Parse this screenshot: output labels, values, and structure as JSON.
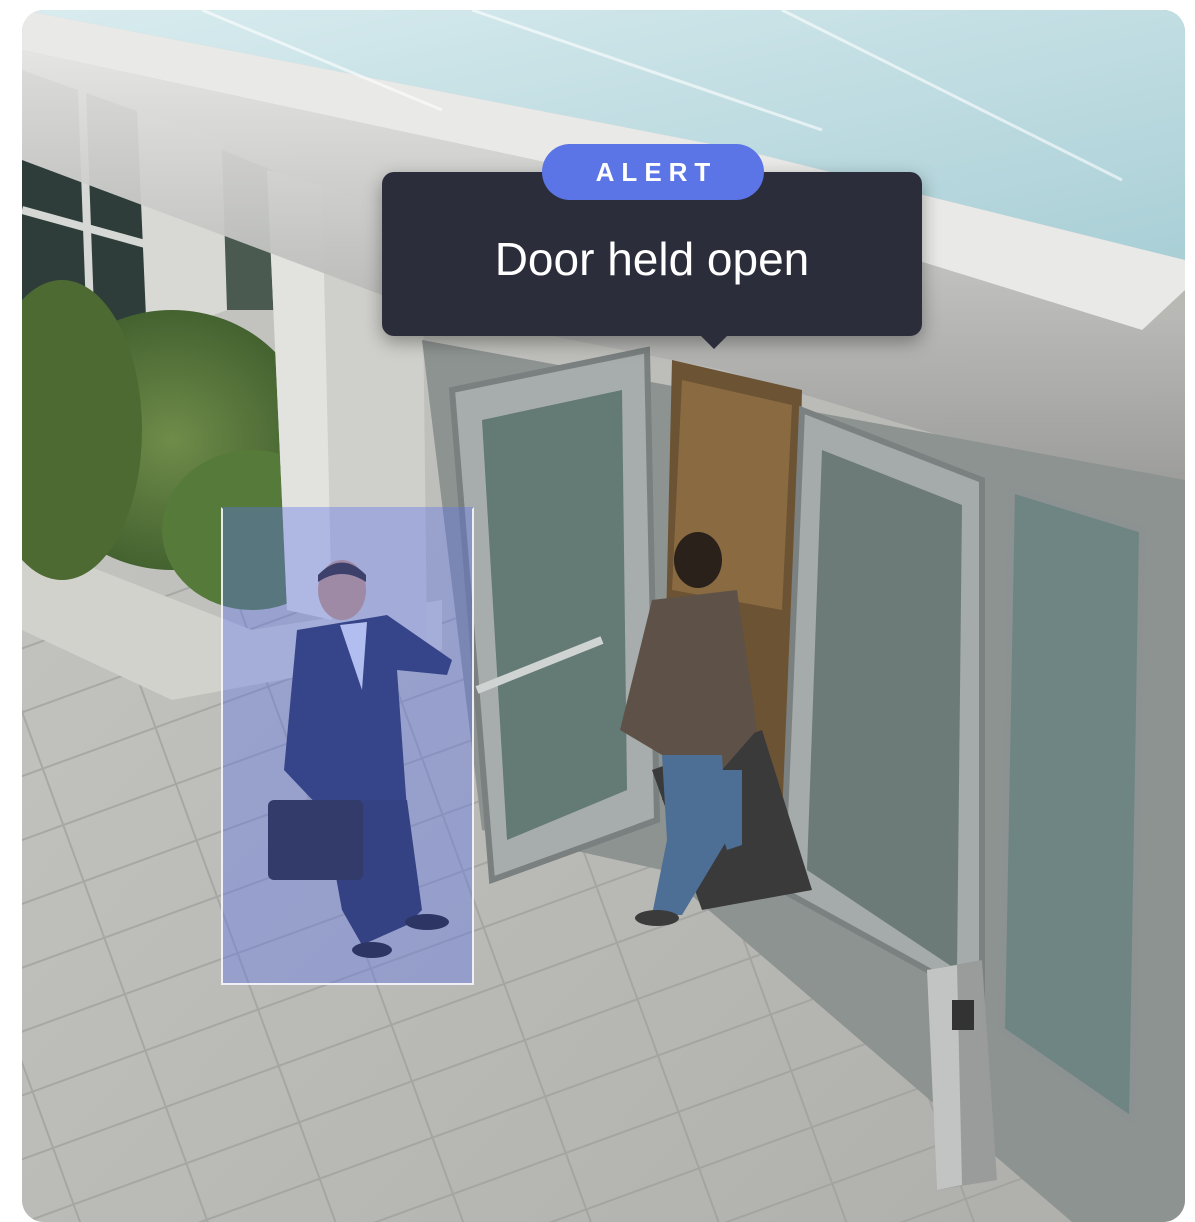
{
  "alert": {
    "badge": "ALERT",
    "message": "Door held open"
  },
  "detection": {
    "subject": "person",
    "box_color": "#5b74e6"
  },
  "colors": {
    "card_bg": "#2b2d3a",
    "accent": "#5b74e6",
    "text": "#ffffff"
  }
}
